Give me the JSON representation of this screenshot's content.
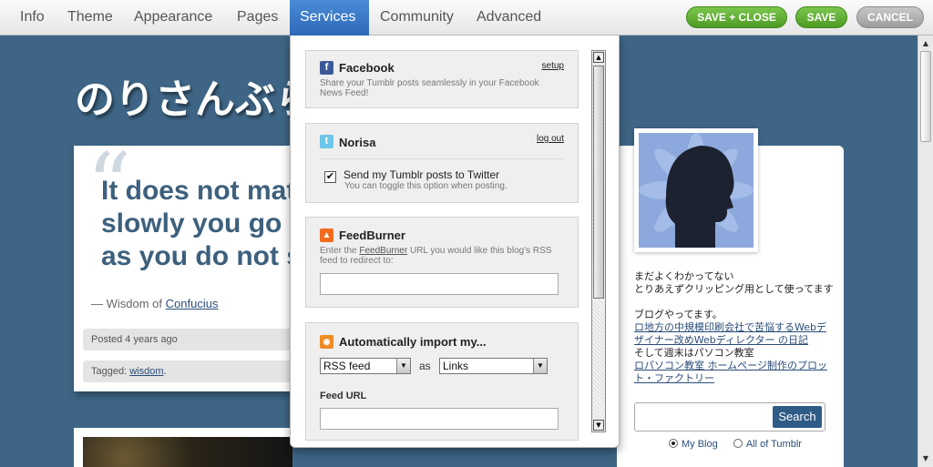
{
  "nav": {
    "tabs": [
      "Info",
      "Theme",
      "Appearance",
      "Pages",
      "Services",
      "Community",
      "Advanced"
    ],
    "active_tab": "Services"
  },
  "actions": {
    "save_close": "SAVE + CLOSE",
    "save": "SAVE",
    "cancel": "CANCEL"
  },
  "blog": {
    "title": "のりさんぶらぐ",
    "quote": "It does not matter how slowly you go so long as you do not stop.",
    "quote_prefix": "— Wisdom of",
    "quote_author": "Confucius",
    "posted": "Posted 4 years ago",
    "tagged_label": "Tagged:",
    "tag": "wisdom",
    "tag_suffix": "."
  },
  "sidebar": {
    "desc_line1": "まだよくわかってない",
    "desc_line2": "とりあえずクリッピング用として使ってます",
    "blog_intro": "ブログやってます。",
    "link1": "ロ地方の中規模印刷会社で苦悩するWebデザイナー改めWebディレクター の日記",
    "weekend": "そして週末はパソコン教室",
    "link2": "ロパソコン教室 ホームページ制作のプロット・ファクトリー",
    "search_button": "Search",
    "search_value": "",
    "radio_my_blog": "My Blog",
    "radio_all": "All of Tumblr"
  },
  "services": {
    "facebook": {
      "title": "Facebook",
      "link": "setup",
      "desc": "Share your Tumblr posts seamlessly in your Facebook News Feed!"
    },
    "twitter": {
      "title": "Norisa",
      "link": "log out",
      "check_label": "Send my Tumblr posts to Twitter",
      "check_hint": "You can toggle this option when posting.",
      "checked": true
    },
    "feedburner": {
      "title": "FeedBurner",
      "desc_pre": "Enter the ",
      "desc_link": "FeedBurner",
      "desc_post": " URL you would like this blog's RSS feed to redirect to:",
      "value": ""
    },
    "import": {
      "title": "Automatically import my...",
      "source": "RSS feed",
      "as_label": "as",
      "type": "Links",
      "feed_url_label": "Feed URL",
      "feed_url_value": ""
    }
  },
  "colors": {
    "background": "#3e6585",
    "active_tab": "#2c69b8",
    "save_green": "#5aa52d",
    "cancel_gray": "#a8a8a8",
    "heading_blue": "#3d607d"
  }
}
